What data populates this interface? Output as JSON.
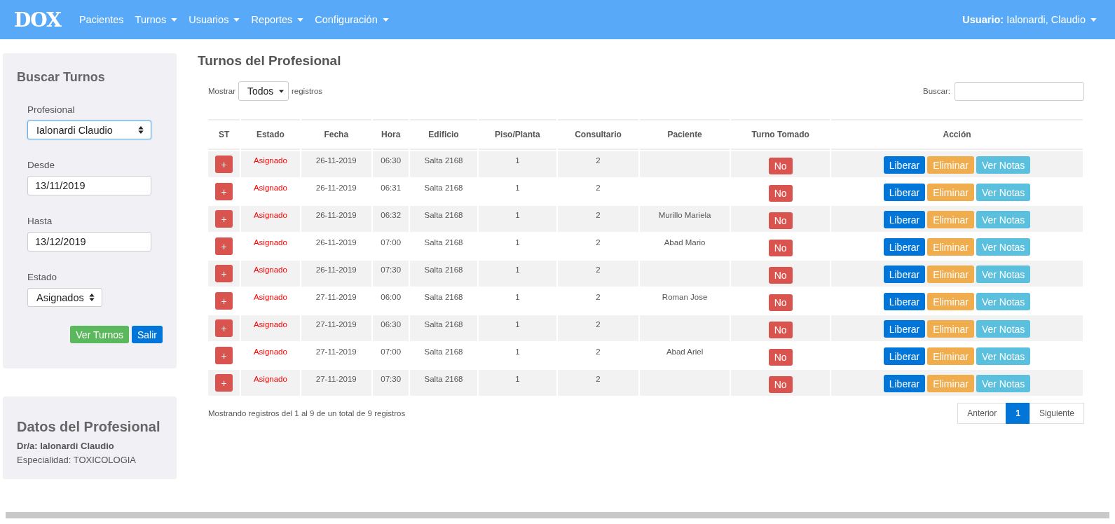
{
  "navbar": {
    "logo": "DOX",
    "items": [
      {
        "label": "Pacientes",
        "dropdown": false
      },
      {
        "label": "Turnos",
        "dropdown": true
      },
      {
        "label": "Usuarios",
        "dropdown": true
      },
      {
        "label": "Reportes",
        "dropdown": true
      },
      {
        "label": "Configuración",
        "dropdown": true
      }
    ],
    "user": "**Usuario:** Ialonardi, Claudio"
  },
  "search_panel": {
    "title": "Buscar Turnos",
    "fields": [
      {
        "label": "Profesional",
        "kind": "select",
        "value": "Ialonardi Claudio",
        "focused": true
      },
      {
        "label": "Desde",
        "kind": "input",
        "value": "13/11/2019",
        "focused": false
      },
      {
        "label": "Hasta",
        "kind": "input",
        "value": "13/12/2019",
        "focused": false
      },
      {
        "label": "Estado",
        "kind": "small-select",
        "value": "Asignados",
        "focused": false
      }
    ],
    "buttons": [
      {
        "label": "Ver Turnos",
        "kind": "success"
      },
      {
        "label": "Salir",
        "kind": "primary"
      }
    ]
  },
  "profile_panel": {
    "title": "Datos del Profesional",
    "doctor": "Dr/a: Ialonardi Claudio",
    "specialty": "Especialidad: TOXICOLOGIA"
  },
  "main": {
    "title": "Turnos del Profesional",
    "show_label": "Mostrar",
    "show_value": "Todos",
    "show_suffix": "registros",
    "search_label": "Buscar:",
    "table": {
      "columns": [
        "ST",
        "Estado",
        "Fecha",
        "Hora",
        "Edificio",
        "Piso/Planta",
        "Consultario",
        "Paciente",
        "Turno Tomado",
        "Acción"
      ],
      "rows": [
        {
          "st": "+",
          "estado": "Asignado",
          "fecha": "26-11-2019",
          "hora": "06:30",
          "edificio": "Salta 2168",
          "piso": "1",
          "consultorio": "2",
          "paciente": "",
          "tomado": "No",
          "actions": [
            {
              "label": "Liberar",
              "kind": "primary"
            },
            {
              "label": "Eliminar",
              "kind": "warning"
            },
            {
              "label": "Ver Notas",
              "kind": "info"
            }
          ]
        },
        {
          "st": "+",
          "estado": "Asignado",
          "fecha": "26-11-2019",
          "hora": "06:31",
          "edificio": "Salta 2168",
          "piso": "1",
          "consultorio": "2",
          "paciente": "",
          "tomado": "No",
          "actions": [
            {
              "label": "Liberar",
              "kind": "primary"
            },
            {
              "label": "Eliminar",
              "kind": "warning"
            },
            {
              "label": "Ver Notas",
              "kind": "info"
            }
          ]
        },
        {
          "st": "+",
          "estado": "Asignado",
          "fecha": "26-11-2019",
          "hora": "06:32",
          "edificio": "Salta 2168",
          "piso": "1",
          "consultorio": "2",
          "paciente": "Murillo Mariela",
          "tomado": "No",
          "actions": [
            {
              "label": "Liberar",
              "kind": "primary"
            },
            {
              "label": "Eliminar",
              "kind": "warning"
            },
            {
              "label": "Ver Notas",
              "kind": "info"
            }
          ]
        },
        {
          "st": "+",
          "estado": "Asignado",
          "fecha": "26-11-2019",
          "hora": "07:00",
          "edificio": "Salta 2168",
          "piso": "1",
          "consultorio": "2",
          "paciente": "Abad Mario",
          "tomado": "No",
          "actions": [
            {
              "label": "Liberar",
              "kind": "primary"
            },
            {
              "label": "Eliminar",
              "kind": "warning"
            },
            {
              "label": "Ver Notas",
              "kind": "info"
            }
          ]
        },
        {
          "st": "+",
          "estado": "Asignado",
          "fecha": "26-11-2019",
          "hora": "07:30",
          "edificio": "Salta 2168",
          "piso": "1",
          "consultorio": "2",
          "paciente": "",
          "tomado": "No",
          "actions": [
            {
              "label": "Liberar",
              "kind": "primary"
            },
            {
              "label": "Eliminar",
              "kind": "warning"
            },
            {
              "label": "Ver Notas",
              "kind": "info"
            }
          ]
        },
        {
          "st": "+",
          "estado": "Asignado",
          "fecha": "27-11-2019",
          "hora": "06:00",
          "edificio": "Salta 2168",
          "piso": "1",
          "consultorio": "2",
          "paciente": "Roman Jose",
          "tomado": "No",
          "actions": [
            {
              "label": "Liberar",
              "kind": "primary"
            },
            {
              "label": "Eliminar",
              "kind": "warning"
            },
            {
              "label": "Ver Notas",
              "kind": "info"
            }
          ]
        },
        {
          "st": "+",
          "estado": "Asignado",
          "fecha": "27-11-2019",
          "hora": "06:30",
          "edificio": "Salta 2168",
          "piso": "1",
          "consultorio": "2",
          "paciente": "",
          "tomado": "No",
          "actions": [
            {
              "label": "Liberar",
              "kind": "primary"
            },
            {
              "label": "Eliminar",
              "kind": "warning"
            },
            {
              "label": "Ver Notas",
              "kind": "info"
            }
          ]
        },
        {
          "st": "+",
          "estado": "Asignado",
          "fecha": "27-11-2019",
          "hora": "07:00",
          "edificio": "Salta 2168",
          "piso": "1",
          "consultorio": "2",
          "paciente": "Abad Ariel",
          "tomado": "No",
          "actions": [
            {
              "label": "Liberar",
              "kind": "primary"
            },
            {
              "label": "Eliminar",
              "kind": "warning"
            },
            {
              "label": "Ver Notas",
              "kind": "info"
            }
          ]
        },
        {
          "st": "+",
          "estado": "Asignado",
          "fecha": "27-11-2019",
          "hora": "07:30",
          "edificio": "Salta 2168",
          "piso": "1",
          "consultorio": "2",
          "paciente": "",
          "tomado": "No",
          "actions": [
            {
              "label": "Liberar",
              "kind": "primary"
            },
            {
              "label": "Eliminar",
              "kind": "warning"
            },
            {
              "label": "Ver Notas",
              "kind": "info"
            }
          ]
        }
      ]
    },
    "info": "Mostrando registros del 1 al 9 de un total de 9 registros",
    "pagination": [
      {
        "label": "Anterior",
        "selected": false
      },
      {
        "label": "1",
        "selected": true
      },
      {
        "label": "Siguiente",
        "selected": false
      }
    ]
  }
}
